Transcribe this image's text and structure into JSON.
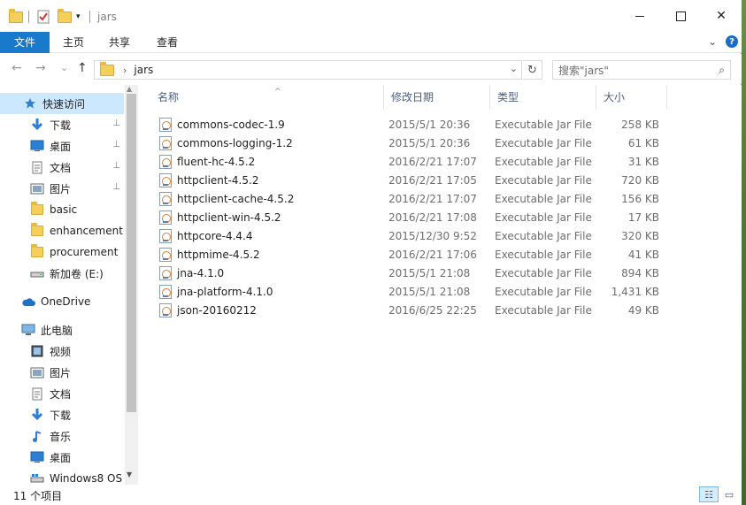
{
  "window": {
    "title": "jars",
    "minimize_glyph": "—",
    "maximize_glyph": "☐",
    "close_glyph": "✕"
  },
  "ribbon": {
    "tabs": [
      "文件",
      "主页",
      "共享",
      "查看"
    ],
    "expand_glyph": "⌄",
    "help_glyph": "?"
  },
  "nav": {
    "back_glyph": "←",
    "forward_glyph": "→",
    "recent_glyph": "⌄",
    "up_glyph": "↑",
    "path_sep": "›",
    "path": "jars",
    "dropdown_glyph": "⌄",
    "refresh_glyph": "↻",
    "search_placeholder": "搜索\"jars\"",
    "search_glyph": "⌕"
  },
  "sidebar": {
    "items": [
      {
        "label": "快速访问",
        "icon": "star-icon"
      },
      {
        "label": "下载",
        "icon": "download-icon",
        "pinned": true
      },
      {
        "label": "桌面",
        "icon": "desktop-icon",
        "pinned": true
      },
      {
        "label": "文档",
        "icon": "document-icon",
        "pinned": true
      },
      {
        "label": "图片",
        "icon": "picture-icon",
        "pinned": true
      },
      {
        "label": "basic",
        "icon": "folder-icon"
      },
      {
        "label": "enhancement",
        "icon": "folder-icon"
      },
      {
        "label": "procurement",
        "icon": "folder-icon"
      },
      {
        "label": "新加卷 (E:)",
        "icon": "drive-icon"
      },
      {
        "label": "OneDrive",
        "icon": "cloud-icon"
      },
      {
        "label": "此电脑",
        "icon": "computer-icon"
      },
      {
        "label": "视频",
        "icon": "video-icon"
      },
      {
        "label": "图片",
        "icon": "picture-icon"
      },
      {
        "label": "文档",
        "icon": "document-icon"
      },
      {
        "label": "下载",
        "icon": "download-icon"
      },
      {
        "label": "音乐",
        "icon": "music-icon"
      },
      {
        "label": "桌面",
        "icon": "desktop-icon"
      },
      {
        "label": "Windows8 OS",
        "icon": "drive-icon"
      }
    ],
    "pin_glyph": "📌"
  },
  "columns": {
    "name": "名称",
    "date": "修改日期",
    "type": "类型",
    "size": "大小"
  },
  "files": [
    {
      "name": "commons-codec-1.9",
      "date": "2015/5/1 20:36",
      "type": "Executable Jar File",
      "size": "258 KB"
    },
    {
      "name": "commons-logging-1.2",
      "date": "2015/5/1 20:36",
      "type": "Executable Jar File",
      "size": "61 KB"
    },
    {
      "name": "fluent-hc-4.5.2",
      "date": "2016/2/21 17:07",
      "type": "Executable Jar File",
      "size": "31 KB"
    },
    {
      "name": "httpclient-4.5.2",
      "date": "2016/2/21 17:05",
      "type": "Executable Jar File",
      "size": "720 KB"
    },
    {
      "name": "httpclient-cache-4.5.2",
      "date": "2016/2/21 17:07",
      "type": "Executable Jar File",
      "size": "156 KB"
    },
    {
      "name": "httpclient-win-4.5.2",
      "date": "2016/2/21 17:08",
      "type": "Executable Jar File",
      "size": "17 KB"
    },
    {
      "name": "httpcore-4.4.4",
      "date": "2015/12/30 9:52",
      "type": "Executable Jar File",
      "size": "320 KB"
    },
    {
      "name": "httpmime-4.5.2",
      "date": "2016/2/21 17:06",
      "type": "Executable Jar File",
      "size": "41 KB"
    },
    {
      "name": "jna-4.1.0",
      "date": "2015/5/1 21:08",
      "type": "Executable Jar File",
      "size": "894 KB"
    },
    {
      "name": "jna-platform-4.1.0",
      "date": "2015/5/1 21:08",
      "type": "Executable Jar File",
      "size": "1,431 KB"
    },
    {
      "name": "json-20160212",
      "date": "2016/6/25 22:25",
      "type": "Executable Jar File",
      "size": "49 KB"
    }
  ],
  "status": {
    "item_count": "11 个项目",
    "details_view_glyph": "☷",
    "tiles_view_glyph": "▭"
  },
  "colors": {
    "accent": "#1979ca",
    "selection": "#cce8ff",
    "folder": "#f4cf5a"
  }
}
